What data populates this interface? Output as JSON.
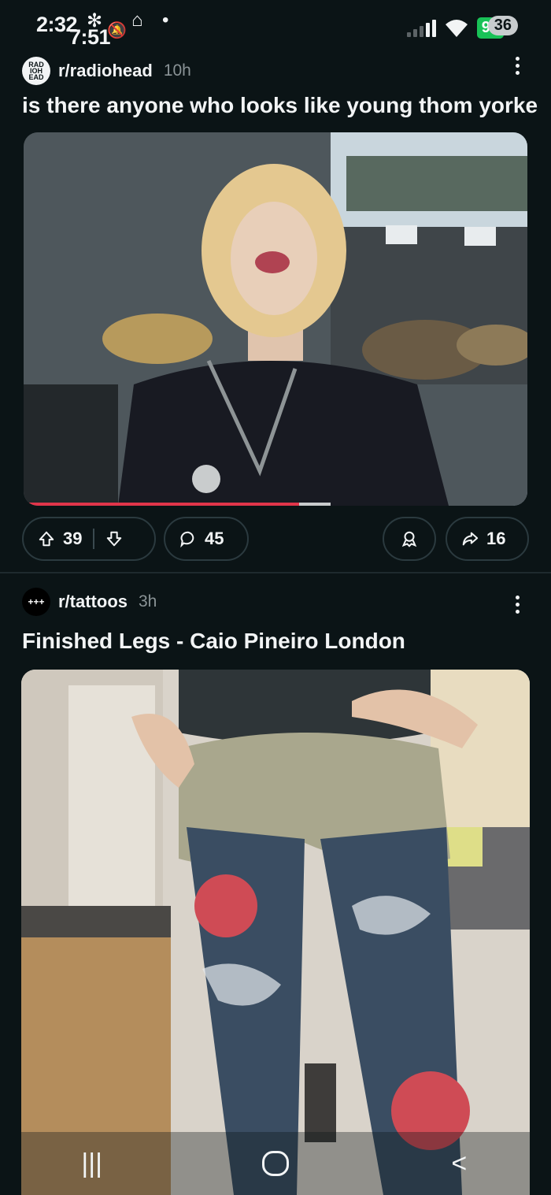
{
  "status": {
    "time_back": "2:32",
    "time_front": "7:51",
    "battery": "94",
    "badge": "36"
  },
  "posts": [
    {
      "subreddit": "r/radiohead",
      "age": "10h",
      "icon_text": "RAD IOH EAD",
      "title": "is there anyone who looks like young thom yorke",
      "upvotes": "39",
      "comments": "45",
      "shares": "16"
    },
    {
      "subreddit": "r/tattoos",
      "age": "3h",
      "icon_text": "+++",
      "title": "Finished Legs - Caio Pineiro London"
    }
  ],
  "colors": {
    "background": "#0b1416",
    "text": "#f2f4f5",
    "muted": "#8a9396",
    "battery": "#19c257",
    "progress": "#e0354a"
  },
  "navigation": {
    "recents": "|||",
    "back": "<"
  }
}
